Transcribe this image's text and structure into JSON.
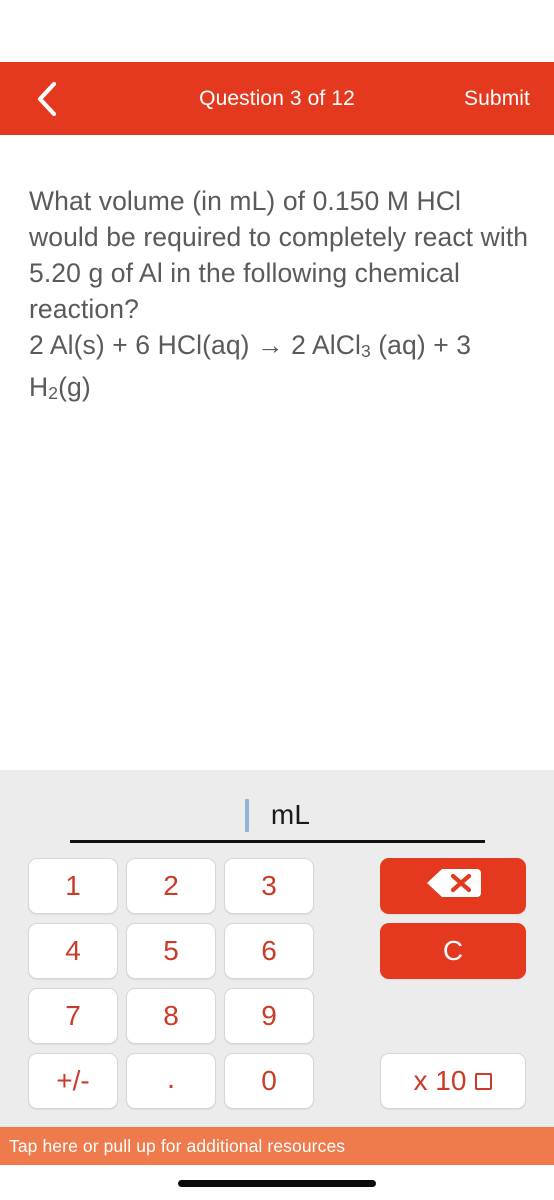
{
  "header": {
    "back_icon": "chevron-left-icon",
    "title": "Question 3 of 12",
    "submit_label": "Submit",
    "background_color": "#E5391F",
    "text_color": "#FFFFFF"
  },
  "question": {
    "line1": "What volume (in mL) of 0.150 M HCl",
    "line2": "would be required to completely",
    "line3": "react with 5.20 g of Al in the",
    "line4": "following chemical reaction?",
    "equation_part1": "2 Al(s) + 6 HCl(aq) → 2 AlCl",
    "equation_sub1": "3",
    "equation_part2": " (aq) +",
    "equation_part3": "3 H",
    "equation_sub2": "2",
    "equation_part4": "(g)",
    "text_color": "#5A5A5A"
  },
  "answer": {
    "value": "",
    "caret_visible": true,
    "caret_color": "#8FB4D9",
    "unit": "mL"
  },
  "keypad": {
    "background_color": "#ECECEC",
    "digit_color": "#CC3A28",
    "keys": [
      {
        "label": "1",
        "name": "key-1"
      },
      {
        "label": "2",
        "name": "key-2"
      },
      {
        "label": "3",
        "name": "key-3"
      },
      {
        "label": "4",
        "name": "key-4"
      },
      {
        "label": "5",
        "name": "key-5"
      },
      {
        "label": "6",
        "name": "key-6"
      },
      {
        "label": "7",
        "name": "key-7"
      },
      {
        "label": "8",
        "name": "key-8"
      },
      {
        "label": "9",
        "name": "key-9"
      },
      {
        "label": "+/-",
        "name": "key-plus-minus"
      },
      {
        "label": ".",
        "name": "key-decimal"
      },
      {
        "label": "0",
        "name": "key-0"
      }
    ],
    "backspace": {
      "icon": "backspace-icon",
      "label": ""
    },
    "clear": {
      "label": "C",
      "name": "key-clear"
    },
    "exponent": {
      "prefix": "x 10",
      "name": "key-exponent"
    }
  },
  "banner": {
    "text": "Tap here or pull up for additional resources",
    "background_color": "#EF7A4C",
    "text_color": "#FFFFFF"
  }
}
